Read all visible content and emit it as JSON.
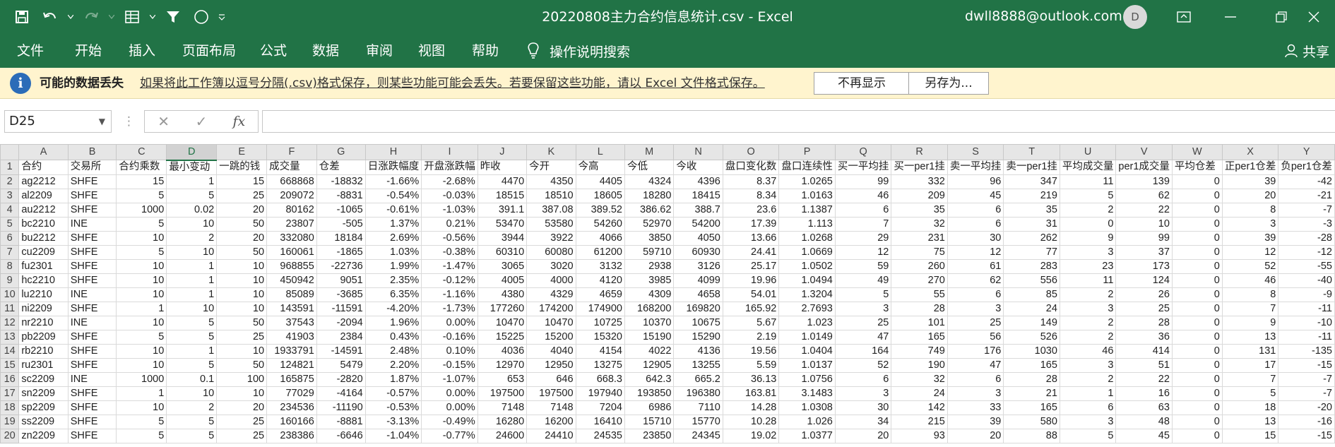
{
  "window": {
    "title": "20220808主力合约信息统计.csv  -  Excel",
    "account": "dwll8888@outlook.com",
    "avatar_initial": "D"
  },
  "ribbon": {
    "tabs": [
      "文件",
      "开始",
      "插入",
      "页面布局",
      "公式",
      "数据",
      "审阅",
      "视图",
      "帮助"
    ],
    "tell_me": "操作说明搜索",
    "share": "共享"
  },
  "message_bar": {
    "title": "可能的数据丢失",
    "text": "如果将此工作簿以逗号分隔(.csv)格式保存，则某些功能可能会丢失。若要保留这些功能，请以 Excel 文件格式保存。",
    "dont_show_label": "不再显示",
    "save_as_label": "另存为..."
  },
  "formula_bar": {
    "name_box": "D25",
    "formula": ""
  },
  "sheet": {
    "selected_cell": "D25",
    "columns": [
      "A",
      "B",
      "C",
      "D",
      "E",
      "F",
      "G",
      "H",
      "I",
      "J",
      "K",
      "L",
      "M",
      "N",
      "O",
      "P",
      "Q",
      "R",
      "S",
      "T",
      "U",
      "V",
      "W",
      "X",
      "Y"
    ],
    "headers": [
      "合约",
      "交易所",
      "合约乘数",
      "最小变动",
      "一跳的钱",
      "成交量",
      "仓差",
      "日涨跌幅度",
      "开盘涨跌幅",
      "昨收",
      "今开",
      "今高",
      "今低",
      "今收",
      "盘口变化数",
      "盘口连续性",
      "买一平均挂",
      "买一per1挂",
      "卖一平均挂",
      "卖一per1挂",
      "平均成交量",
      "per1成交量",
      "平均仓差",
      "正per1仓差",
      "负per1仓差"
    ],
    "rows": [
      [
        "ag2212",
        "SHFE",
        "15",
        "1",
        "15",
        "668868",
        "-18832",
        "-1.66%",
        "-2.68%",
        "4470",
        "4350",
        "4405",
        "4324",
        "4396",
        "8.37",
        "1.0265",
        "99",
        "332",
        "96",
        "347",
        "11",
        "139",
        "0",
        "39",
        "-42"
      ],
      [
        "al2209",
        "SHFE",
        "5",
        "5",
        "25",
        "209072",
        "-8831",
        "-0.54%",
        "-0.03%",
        "18515",
        "18510",
        "18605",
        "18280",
        "18415",
        "8.34",
        "1.0163",
        "46",
        "209",
        "45",
        "219",
        "5",
        "62",
        "0",
        "20",
        "-21"
      ],
      [
        "au2212",
        "SHFE",
        "1000",
        "0.02",
        "20",
        "80162",
        "-1065",
        "-0.61%",
        "-1.03%",
        "391.1",
        "387.08",
        "389.52",
        "386.62",
        "388.7",
        "23.6",
        "1.1387",
        "6",
        "35",
        "6",
        "35",
        "2",
        "22",
        "0",
        "8",
        "-7"
      ],
      [
        "bc2210",
        "INE",
        "5",
        "10",
        "50",
        "23807",
        "-505",
        "1.37%",
        "0.21%",
        "53470",
        "53580",
        "54260",
        "52970",
        "54200",
        "17.39",
        "1.113",
        "7",
        "32",
        "6",
        "31",
        "0",
        "10",
        "0",
        "3",
        "-3"
      ],
      [
        "bu2212",
        "SHFE",
        "10",
        "2",
        "20",
        "332080",
        "18184",
        "2.69%",
        "-0.56%",
        "3944",
        "3922",
        "4066",
        "3850",
        "4050",
        "13.66",
        "1.0268",
        "29",
        "231",
        "30",
        "262",
        "9",
        "99",
        "0",
        "39",
        "-28"
      ],
      [
        "cu2209",
        "SHFE",
        "5",
        "10",
        "50",
        "160061",
        "-1865",
        "1.03%",
        "-0.38%",
        "60310",
        "60080",
        "61200",
        "59710",
        "60930",
        "24.41",
        "1.0669",
        "12",
        "75",
        "12",
        "77",
        "3",
        "37",
        "0",
        "12",
        "-12"
      ],
      [
        "fu2301",
        "SHFE",
        "10",
        "1",
        "10",
        "968855",
        "-22736",
        "1.99%",
        "-1.47%",
        "3065",
        "3020",
        "3132",
        "2938",
        "3126",
        "25.17",
        "1.0502",
        "59",
        "260",
        "61",
        "283",
        "23",
        "173",
        "0",
        "52",
        "-55"
      ],
      [
        "hc2210",
        "SHFE",
        "10",
        "1",
        "10",
        "450942",
        "9051",
        "2.35%",
        "-0.12%",
        "4005",
        "4000",
        "4120",
        "3985",
        "4099",
        "19.96",
        "1.0494",
        "49",
        "270",
        "62",
        "556",
        "11",
        "124",
        "0",
        "46",
        "-40"
      ],
      [
        "lu2210",
        "INE",
        "10",
        "1",
        "10",
        "85089",
        "-3685",
        "6.35%",
        "-1.16%",
        "4380",
        "4329",
        "4659",
        "4309",
        "4658",
        "54.01",
        "1.3204",
        "5",
        "55",
        "6",
        "85",
        "2",
        "26",
        "0",
        "8",
        "-9"
      ],
      [
        "ni2209",
        "SHFE",
        "1",
        "10",
        "10",
        "143591",
        "-11591",
        "-4.20%",
        "-1.73%",
        "177260",
        "174200",
        "174900",
        "168200",
        "169820",
        "165.92",
        "2.7693",
        "3",
        "28",
        "3",
        "24",
        "3",
        "25",
        "0",
        "7",
        "-11"
      ],
      [
        "nr2210",
        "INE",
        "10",
        "5",
        "50",
        "37543",
        "-2094",
        "1.96%",
        "0.00%",
        "10470",
        "10470",
        "10725",
        "10370",
        "10675",
        "5.67",
        "1.023",
        "25",
        "101",
        "25",
        "149",
        "2",
        "28",
        "0",
        "9",
        "-10"
      ],
      [
        "pb2209",
        "SHFE",
        "5",
        "5",
        "25",
        "41903",
        "2384",
        "0.43%",
        "-0.16%",
        "15225",
        "15200",
        "15320",
        "15190",
        "15290",
        "2.19",
        "1.0149",
        "47",
        "165",
        "56",
        "526",
        "2",
        "36",
        "0",
        "13",
        "-11"
      ],
      [
        "rb2210",
        "SHFE",
        "10",
        "1",
        "10",
        "1933791",
        "-14591",
        "2.48%",
        "0.10%",
        "4036",
        "4040",
        "4154",
        "4022",
        "4136",
        "19.56",
        "1.0404",
        "164",
        "749",
        "176",
        "1030",
        "46",
        "414",
        "0",
        "131",
        "-135"
      ],
      [
        "ru2301",
        "SHFE",
        "10",
        "5",
        "50",
        "124821",
        "5479",
        "2.20%",
        "-0.15%",
        "12970",
        "12950",
        "13275",
        "12905",
        "13255",
        "5.59",
        "1.0137",
        "52",
        "190",
        "47",
        "165",
        "3",
        "51",
        "0",
        "17",
        "-15"
      ],
      [
        "sc2209",
        "INE",
        "1000",
        "0.1",
        "100",
        "165875",
        "-2820",
        "1.87%",
        "-1.07%",
        "653",
        "646",
        "668.3",
        "642.3",
        "665.2",
        "36.13",
        "1.0756",
        "6",
        "32",
        "6",
        "28",
        "2",
        "22",
        "0",
        "7",
        "-7"
      ],
      [
        "sn2209",
        "SHFE",
        "1",
        "10",
        "10",
        "77029",
        "-4164",
        "-0.57%",
        "0.00%",
        "197500",
        "197500",
        "197940",
        "193850",
        "196380",
        "163.81",
        "3.1483",
        "3",
        "24",
        "3",
        "21",
        "1",
        "16",
        "0",
        "5",
        "-7"
      ],
      [
        "sp2209",
        "SHFE",
        "10",
        "2",
        "20",
        "234536",
        "-11190",
        "-0.53%",
        "0.00%",
        "7148",
        "7148",
        "7204",
        "6986",
        "7110",
        "14.28",
        "1.0308",
        "30",
        "142",
        "33",
        "165",
        "6",
        "63",
        "0",
        "18",
        "-20"
      ],
      [
        "ss2209",
        "SHFE",
        "5",
        "5",
        "25",
        "160166",
        "-8881",
        "-3.13%",
        "-0.49%",
        "16280",
        "16200",
        "16410",
        "15710",
        "15770",
        "10.28",
        "1.026",
        "34",
        "215",
        "39",
        "580",
        "3",
        "48",
        "0",
        "13",
        "-16"
      ],
      [
        "zn2209",
        "SHFE",
        "5",
        "5",
        "25",
        "238386",
        "-6646",
        "-1.04%",
        "-0.77%",
        "24600",
        "24410",
        "24535",
        "23850",
        "24345",
        "19.02",
        "1.0377",
        "20",
        "93",
        "20",
        "88",
        "5",
        "45",
        "0",
        "15",
        "-15"
      ]
    ]
  }
}
